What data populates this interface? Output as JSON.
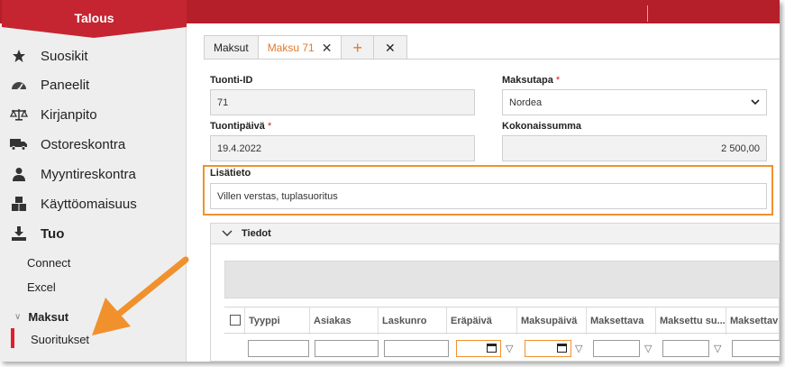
{
  "app": {
    "module_title": "Talous"
  },
  "sidebar": {
    "items": [
      {
        "label": "Suosikit",
        "icon": "star-icon"
      },
      {
        "label": "Paneelit",
        "icon": "dashboard-icon"
      },
      {
        "label": "Kirjanpito",
        "icon": "scales-icon"
      },
      {
        "label": "Ostoreskontra",
        "icon": "truck-icon"
      },
      {
        "label": "Myyntireskontra",
        "icon": "person-icon"
      },
      {
        "label": "Käyttöomaisuus",
        "icon": "boxes-icon"
      },
      {
        "label": "Tuo",
        "icon": "download-icon"
      }
    ],
    "tuo_sub": [
      "Connect",
      "Excel"
    ],
    "group": {
      "label": "Maksut",
      "items": [
        "Suoritukset"
      ]
    }
  },
  "tabs": [
    {
      "label": "Maksut"
    },
    {
      "label": "Maksu 71"
    }
  ],
  "form": {
    "tuonti_id": {
      "label": "Tuonti-ID",
      "value": "71"
    },
    "maksutapa": {
      "label": "Maksutapa",
      "value": "Nordea"
    },
    "tuontipaiva": {
      "label": "Tuontipäivä",
      "value": "19.4.2022"
    },
    "kokonaissumma": {
      "label": "Kokonaissumma",
      "value": "2 500,00"
    },
    "lisatieto": {
      "label": "Lisätieto",
      "value": "Villen verstas, tuplasuoritus"
    },
    "required_mark": "*"
  },
  "details": {
    "title": "Tiedot",
    "columns": [
      "Tyyppi",
      "Asiakas",
      "Laskunro",
      "Eräpäivä",
      "Maksupäivä",
      "Maksettava",
      "Maksettu su...",
      "Maksettav"
    ]
  },
  "colors": {
    "brand": "#b41f2a",
    "accent": "#f0912e",
    "active": "#e0202a"
  }
}
